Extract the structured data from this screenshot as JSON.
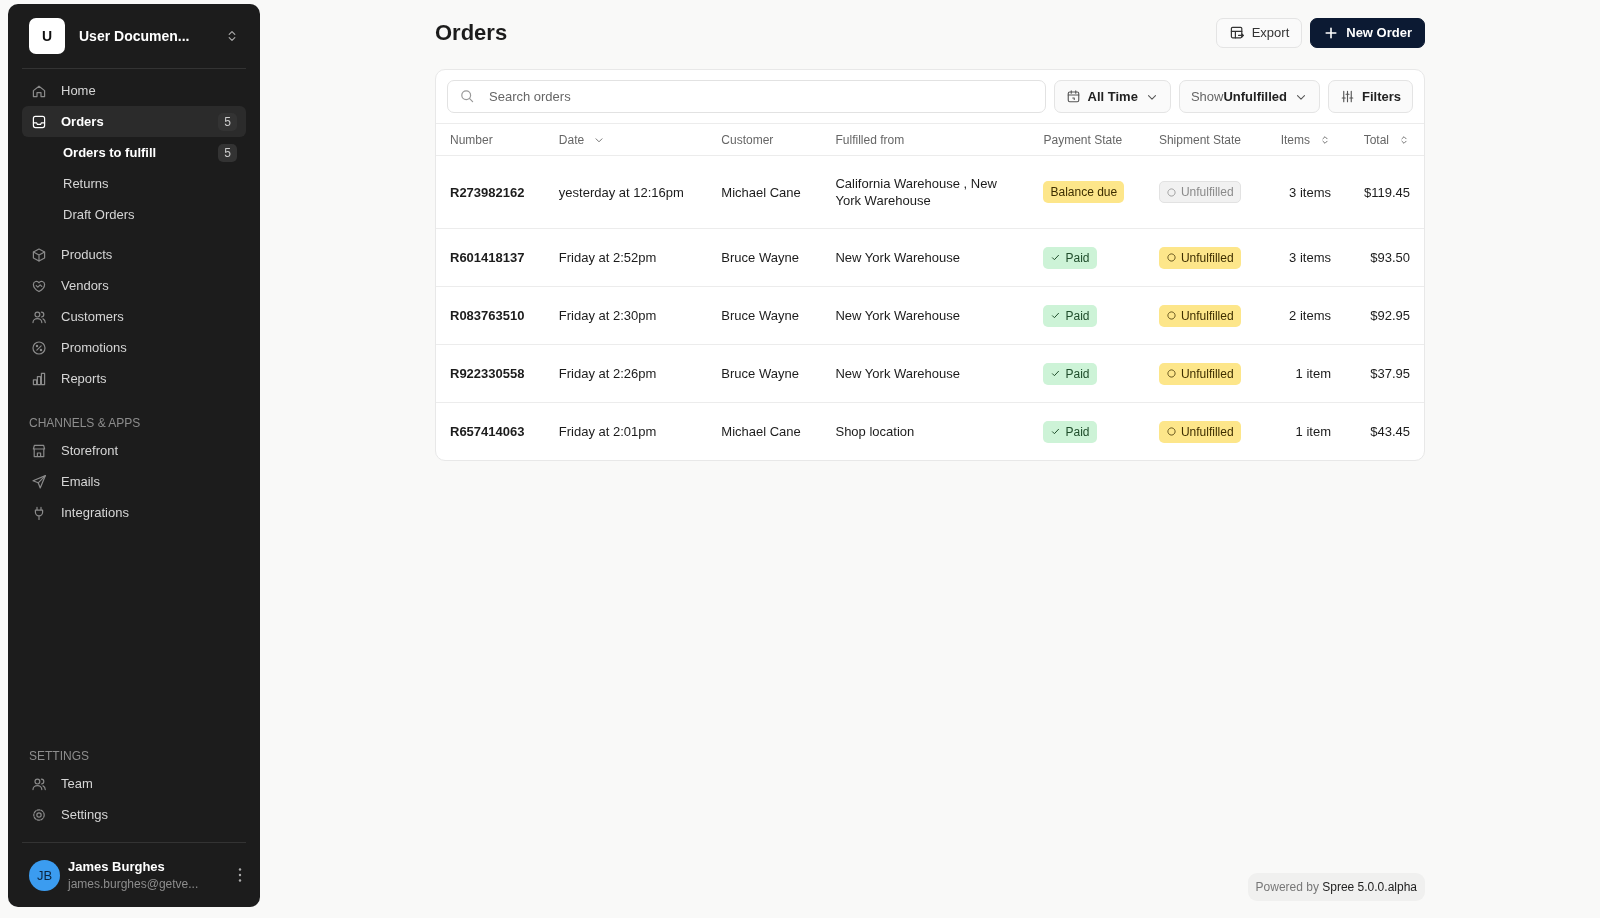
{
  "sidebar": {
    "workspace": {
      "initial": "U",
      "name": "User Documen..."
    },
    "nav": [
      {
        "label": "Home",
        "selected": false
      },
      {
        "label": "Orders",
        "selected": true,
        "count": "5",
        "children": [
          {
            "label": "Orders to fulfill",
            "selected": true,
            "count": "5"
          },
          {
            "label": "Returns",
            "selected": false
          },
          {
            "label": "Draft Orders",
            "selected": false
          }
        ]
      },
      {
        "label": "Products",
        "selected": false
      },
      {
        "label": "Vendors",
        "selected": false
      },
      {
        "label": "Customers",
        "selected": false
      },
      {
        "label": "Promotions",
        "selected": false
      },
      {
        "label": "Reports",
        "selected": false
      }
    ],
    "sections": [
      {
        "heading": "CHANNELS & APPS",
        "items": [
          {
            "label": "Storefront",
            "selected": false
          },
          {
            "label": "Emails",
            "selected": false
          },
          {
            "label": "Integrations",
            "selected": false
          }
        ]
      },
      {
        "heading": "SETTINGS",
        "items": [
          {
            "label": "Team",
            "selected": false
          },
          {
            "label": "Settings",
            "selected": false
          }
        ]
      }
    ],
    "user": {
      "initials": "JB",
      "name": "James Burghes",
      "email": "james.burghes@getve..."
    }
  },
  "page": {
    "title": "Orders",
    "actions": [
      {
        "label": "Export",
        "kind": "secondary"
      },
      {
        "label": "New Order",
        "kind": "primary"
      }
    ]
  },
  "toolbar": {
    "search": {
      "placeholder": "Search orders"
    },
    "date_filter": "All Time",
    "show_filter": {
      "prefix": "Show",
      "value": "Unfulfilled"
    },
    "filters": "Filters"
  },
  "table": {
    "columns": [
      {
        "label": "Number"
      },
      {
        "label": "Date",
        "sorted": true
      },
      {
        "label": "Customer"
      },
      {
        "label": "Fulfilled from"
      },
      {
        "label": "Payment State"
      },
      {
        "label": "Shipment State"
      },
      {
        "label": "Items",
        "sorted": false
      },
      {
        "label": "Total",
        "sorted": false
      }
    ],
    "rows": [
      {
        "number": "R273982162",
        "date": "yesterday at 12:16pm",
        "customer": "Michael Cane",
        "fulfilled_from": "California Warehouse , New York Warehouse",
        "payment": {
          "label": "Balance due",
          "kind": "warning"
        },
        "shipment": {
          "label": "Unfulfilled",
          "kind": "muted"
        },
        "items": "3 items",
        "total": "$119.45"
      },
      {
        "number": "R601418137",
        "date": "Friday at 2:52pm",
        "customer": "Bruce Wayne",
        "fulfilled_from": "New York Warehouse",
        "payment": {
          "label": "Paid",
          "kind": "success"
        },
        "shipment": {
          "label": "Unfulfilled",
          "kind": "warning"
        },
        "items": "3 items",
        "total": "$93.50"
      },
      {
        "number": "R083763510",
        "date": "Friday at 2:30pm",
        "customer": "Bruce Wayne",
        "fulfilled_from": "New York Warehouse",
        "payment": {
          "label": "Paid",
          "kind": "success"
        },
        "shipment": {
          "label": "Unfulfilled",
          "kind": "warning"
        },
        "items": "2 items",
        "total": "$92.95"
      },
      {
        "number": "R922330558",
        "date": "Friday at 2:26pm",
        "customer": "Bruce Wayne",
        "fulfilled_from": "New York Warehouse",
        "payment": {
          "label": "Paid",
          "kind": "success"
        },
        "shipment": {
          "label": "Unfulfilled",
          "kind": "warning"
        },
        "items": "1 item",
        "total": "$37.95"
      },
      {
        "number": "R657414063",
        "date": "Friday at 2:01pm",
        "customer": "Michael Cane",
        "fulfilled_from": "Shop location",
        "payment": {
          "label": "Paid",
          "kind": "success"
        },
        "shipment": {
          "label": "Unfulfilled",
          "kind": "warning"
        },
        "items": "1 item",
        "total": "$43.45"
      }
    ]
  },
  "footer": {
    "prefix": "Powered by",
    "product": "Spree 5.0.0.alpha"
  }
}
